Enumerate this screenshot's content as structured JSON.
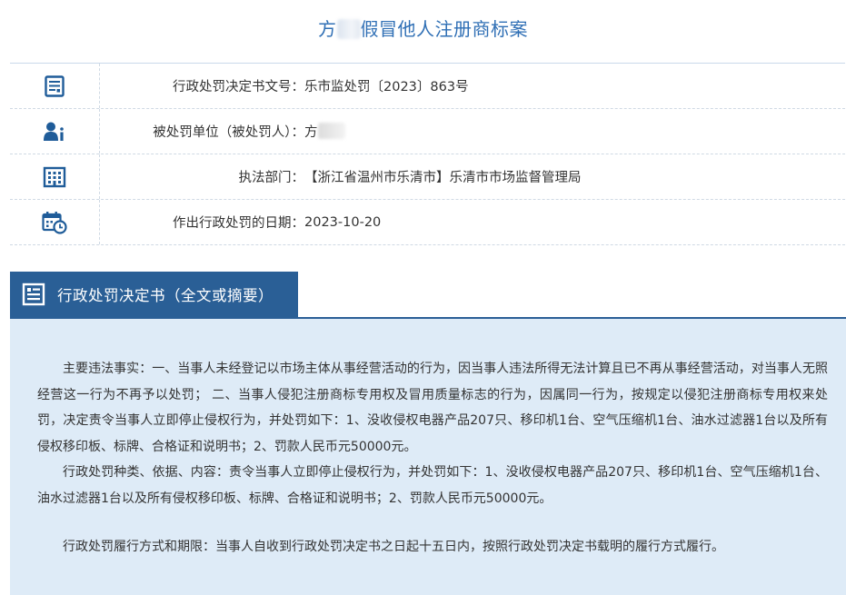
{
  "page": {
    "title_prefix": "方",
    "title_suffix": "假冒他人注册商标案"
  },
  "info": [
    {
      "icon": "document-icon",
      "label": "行政处罚决定书文号：",
      "value": "乐市监处罚〔2023〕863号"
    },
    {
      "icon": "user-info-icon",
      "label": "被处罚单位（被处罚人）：",
      "value": "方"
    },
    {
      "icon": "building-icon",
      "label": "执法部门：",
      "value": "【浙江省温州市乐清市】乐清市市场监督管理局"
    },
    {
      "icon": "calendar-clock-icon",
      "label": "作出行政处罚的日期：",
      "value": "2023-10-20"
    }
  ],
  "section": {
    "icon": "document-list-icon",
    "title": "行政处罚决定书（全文或摘要）"
  },
  "content": {
    "p1": "主要违法事实：一、当事人未经登记以市场主体从事经营活动的行为，因当事人违法所得无法计算且已不再从事经营活动，对当事人无照经营这一行为不再予以处罚； 二、当事人侵犯注册商标专用权及冒用质量标志的行为，因属同一行为，按规定以侵犯注册商标专用权来处罚，决定责令当事人立即停止侵权行为，并处罚如下：1、没收侵权电器产品207只、移印机1台、空气压缩机1台、油水过滤器1台以及所有侵权移印板、标牌、合格证和说明书；2、罚款人民币元50000元。",
    "p2": "行政处罚种类、依据、内容：责令当事人立即停止侵权行为，并处罚如下：1、没收侵权电器产品207只、移印机1台、空气压缩机1台、油水过滤器1台以及所有侵权移印板、标牌、合格证和说明书；2、罚款人民币元50000元。",
    "p3": "行政处罚履行方式和期限：当事人自收到行政处罚决定书之日起十五日内，按照行政处罚决定书载明的履行方式履行。"
  },
  "colors": {
    "title": "#2f6fb5",
    "accent": "#2a5f96",
    "content_bg": "#deebf7"
  }
}
